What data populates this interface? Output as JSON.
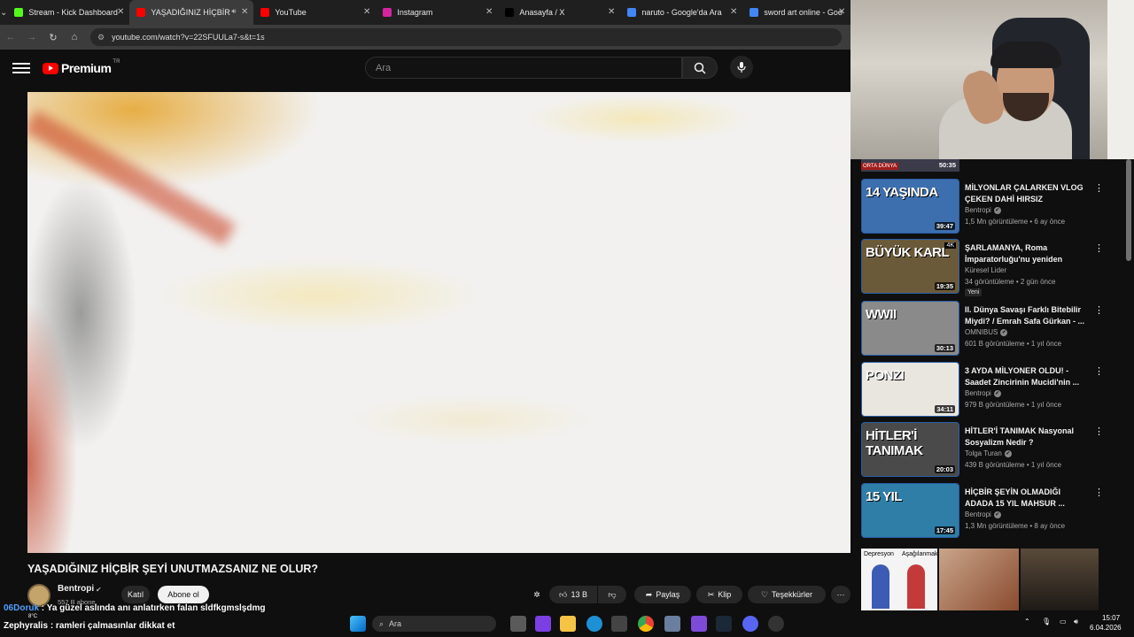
{
  "browser": {
    "tabs": [
      {
        "label": "Stream - Kick Dashboard",
        "icon": "kick-icon",
        "color": "#53fc18",
        "active": false
      },
      {
        "label": "YAŞADIĞINIZ HİÇBİR",
        "icon": "youtube-icon",
        "color": "#ff0000",
        "active": true
      },
      {
        "label": "YouTube",
        "icon": "youtube-icon",
        "color": "#ff0000",
        "active": false
      },
      {
        "label": "Instagram",
        "icon": "instagram-icon",
        "color": "#d6249f",
        "active": false
      },
      {
        "label": "Anasayfa / X",
        "icon": "x-icon",
        "color": "#000000",
        "active": false
      },
      {
        "label": "naruto - Google'da Ara",
        "icon": "google-icon",
        "color": "#4285f4",
        "active": false
      },
      {
        "label": "sword art online - Goo",
        "icon": "google-icon",
        "color": "#4285f4",
        "active": false
      }
    ],
    "url": "youtube.com/watch?v=22SFUULa7-s&t=1s"
  },
  "masthead": {
    "brand": "Premium",
    "country": "TR",
    "search_placeholder": "Ara"
  },
  "video": {
    "title": "YAŞADIĞINIZ HİÇBİR ŞEYİ UNUTMAZSANIZ NE OLUR?",
    "channel": "Bentropi",
    "subscribers": "552 B abone",
    "join_label": "Katıl",
    "subscribe_label": "Abone ol",
    "likes": "13 B",
    "share_label": "Paylaş",
    "clip_label": "Klip",
    "thanks_label": "Teşekkürler"
  },
  "sidebar": {
    "partial": {
      "duration": "50:35",
      "label": "ORTA DÜNYA"
    },
    "items": [
      {
        "title": "MİLYONLAR ÇALARKEN VLOG ÇEKEN DAHİ HIRSIZ",
        "channel": "Bentropi",
        "meta": "1,5 Mn görüntüleme • 6 ay önce",
        "duration": "39:47",
        "thumb_text": "14 YAŞINDA",
        "thumb_bg": "#3d6fae",
        "verified": true
      },
      {
        "title": "ŞARLAMANYA, Roma İmparatorluğu'nu yeniden kura...",
        "channel": "Küresel Lider",
        "meta": "34 görüntüleme • 2 gün önce",
        "duration": "19:35",
        "thumb_text": "BÜYÜK KARL",
        "thumb_bg": "#6b5a3a",
        "badge": "4K",
        "new_badge": "Yeni",
        "verified": false
      },
      {
        "title": "II. Dünya Savaşı Farklı Bitebilir Miydi? / Emrah Safa Gürkan - ...",
        "channel": "OMNIBUS",
        "meta": "601 B görüntüleme • 1 yıl önce",
        "duration": "30:13",
        "thumb_text": "WWII",
        "thumb_bg": "#8a8a8a",
        "verified": true
      },
      {
        "title": "3 AYDA MİLYONER OLDU! - Saadet Zincirinin Mucidi'nin ...",
        "channel": "Bentropi",
        "meta": "979 B görüntüleme • 1 yıl önce",
        "duration": "34:11",
        "thumb_text": "PONZI",
        "thumb_bg": "#e9e6df",
        "verified": true
      },
      {
        "title": "HİTLER'İ TANIMAK Nasyonal Sosyalizm Nedir ?",
        "channel": "Tolga Turan",
        "meta": "439 B görüntüleme • 1 yıl önce",
        "duration": "20:03",
        "thumb_text": "HİTLER'İ TANIMAK",
        "thumb_bg": "#4a4a4a",
        "verified": true
      },
      {
        "title": "HİÇBİR ŞEYİN OLMADIĞI ADADA 15 YIL MAHSUR ...",
        "channel": "Bentropi",
        "meta": "1,3 Mn görüntüleme • 8 ay önce",
        "duration": "17:45",
        "thumb_text": "15 YIL",
        "thumb_bg": "#2e7ea8",
        "verified": true
      }
    ],
    "bottom_labels": [
      "Depresyon",
      "Aşağılanmak"
    ]
  },
  "chat": {
    "lines": [
      {
        "user": "06Doruk",
        "message": ": Ya güzel aslında anı anlatırken falan sldfkgmslşdmg"
      },
      {
        "user": "Zephyralis",
        "message": ": ramleri çalmasınlar dikkat et"
      }
    ],
    "temperature": "8°C"
  },
  "taskbar": {
    "search_placeholder": "Ara",
    "time": "15:07",
    "date": "6.04.2026"
  }
}
